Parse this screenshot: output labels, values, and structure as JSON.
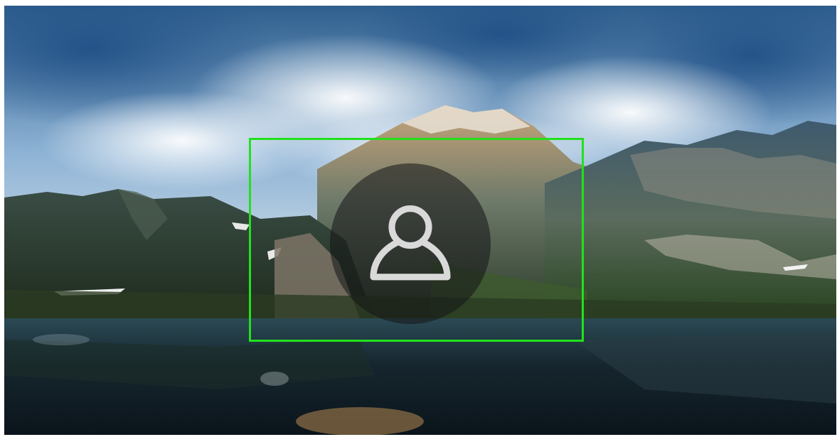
{
  "lock_screen": {
    "background_scene": "mountain-lake-landscape",
    "user_avatar_icon": "user-icon"
  },
  "colors": {
    "focus_outline": "#22e11c",
    "avatar_circle": "#141416",
    "icon_stroke": "#d9d9d9",
    "sky_top": "#2f5f8e",
    "water": "#0f1c24"
  }
}
